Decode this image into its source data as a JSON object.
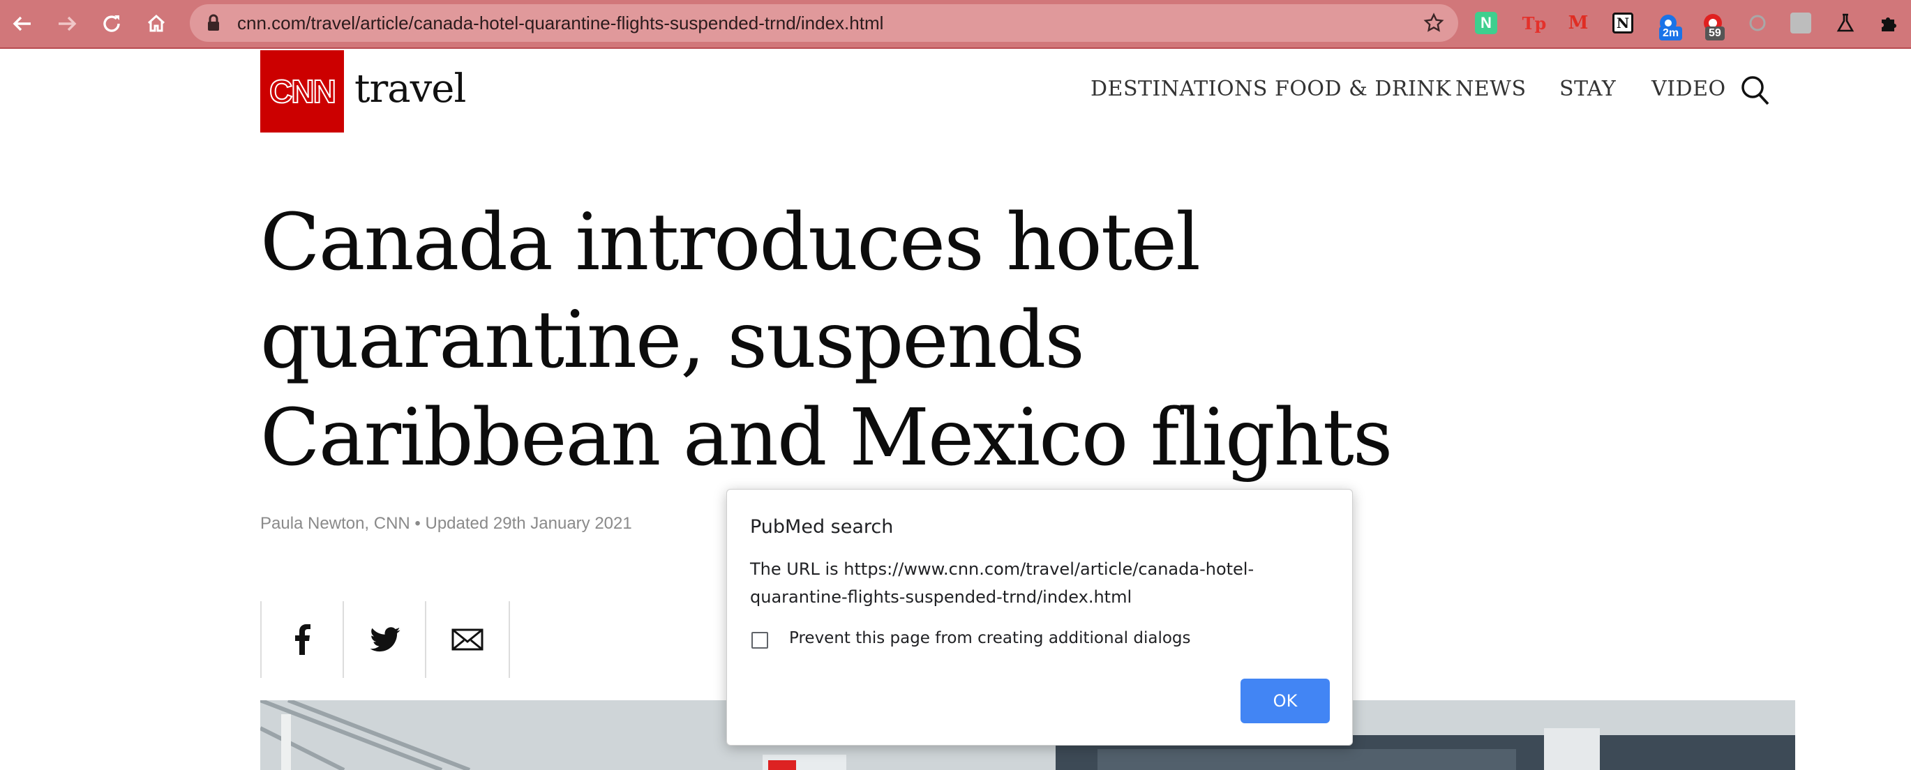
{
  "browser": {
    "url": "cnn.com/travel/article/canada-hotel-quarantine-flights-suspended-trnd/index.html",
    "extensions": [
      {
        "name": "n-extension-icon",
        "label": "N"
      },
      {
        "name": "tp-extension-icon",
        "label": "Tp"
      },
      {
        "name": "m-extension-icon",
        "label": "M"
      },
      {
        "name": "notion-extension-icon",
        "label": "N"
      },
      {
        "name": "timer-extension-icon",
        "badge": "2m"
      },
      {
        "name": "red-extension-icon",
        "badge": "59"
      },
      {
        "name": "circle-extension-icon"
      },
      {
        "name": "grey-extension-icon"
      },
      {
        "name": "flask-extension-icon"
      },
      {
        "name": "puzzle-extension-icon"
      }
    ]
  },
  "site": {
    "logo": "CNN",
    "section": "travel",
    "nav": [
      "DESTINATIONS",
      "FOOD & DRINK",
      "NEWS",
      "STAY",
      "VIDEO"
    ]
  },
  "article": {
    "headline": "Canada introduces hotel quarantine, suspends Caribbean and Mexico flights",
    "byline": "Paula Newton, CNN • Updated 29th January 2021"
  },
  "dialog": {
    "title": "PubMed search",
    "message": "The URL is https://www.cnn.com/travel/article/canada-hotel-quarantine-flights-suspended-trnd/index.html",
    "checkbox_label": "Prevent this page from creating additional dialogs",
    "ok_label": "OK"
  },
  "colors": {
    "toolbar": "#d1777a",
    "cnn_red": "#cc0000",
    "ok_button": "#4285f4"
  }
}
